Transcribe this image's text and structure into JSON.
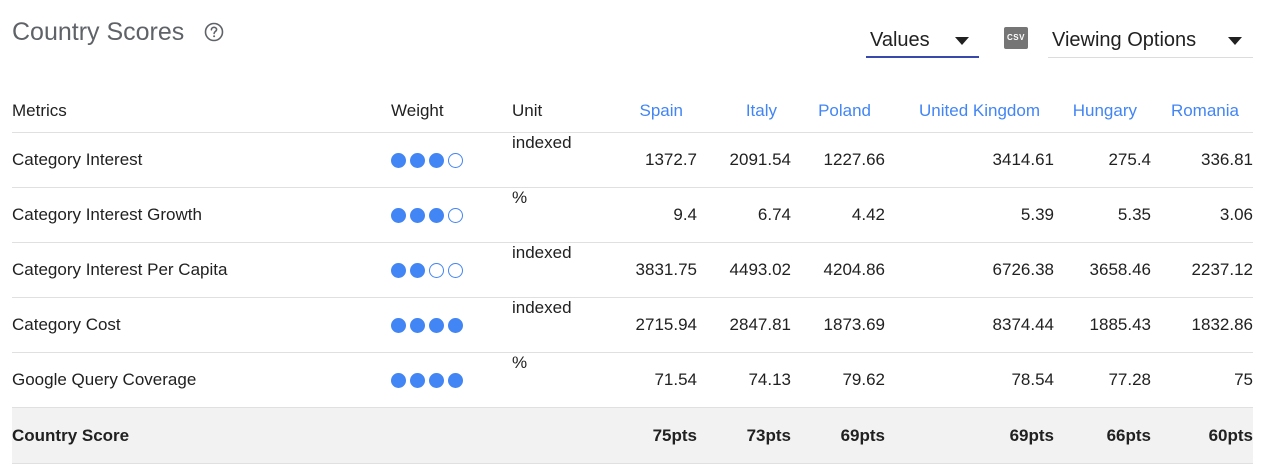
{
  "header": {
    "title": "Country Scores",
    "values_dropdown": "Values",
    "csv_label": "CSV",
    "viewing_dropdown": "Viewing Options"
  },
  "table": {
    "columns": {
      "metric": "Metrics",
      "weight": "Weight",
      "unit": "Unit",
      "countries": [
        "Spain",
        "Italy",
        "Poland",
        "United Kingdom",
        "Hungary",
        "Romania"
      ]
    },
    "rows": [
      {
        "metric": "Category Interest",
        "weight": 3,
        "weight_max": 4,
        "unit": "indexed",
        "values": [
          "1372.7",
          "2091.54",
          "1227.66",
          "3414.61",
          "275.4",
          "336.81"
        ]
      },
      {
        "metric": "Category Interest Growth",
        "weight": 3,
        "weight_max": 4,
        "unit": "%",
        "values": [
          "9.4",
          "6.74",
          "4.42",
          "5.39",
          "5.35",
          "3.06"
        ]
      },
      {
        "metric": "Category Interest Per Capita",
        "weight": 2,
        "weight_max": 4,
        "unit": "indexed",
        "values": [
          "3831.75",
          "4493.02",
          "4204.86",
          "6726.38",
          "3658.46",
          "2237.12"
        ]
      },
      {
        "metric": "Category Cost",
        "weight": 4,
        "weight_max": 4,
        "unit": "indexed",
        "values": [
          "2715.94",
          "2847.81",
          "1873.69",
          "8374.44",
          "1885.43",
          "1832.86"
        ]
      },
      {
        "metric": "Google Query Coverage",
        "weight": 4,
        "weight_max": 4,
        "unit": "%",
        "values": [
          "71.54",
          "74.13",
          "79.62",
          "78.54",
          "77.28",
          "75"
        ]
      }
    ],
    "score_row": {
      "label": "Country Score",
      "values": [
        "75pts",
        "73pts",
        "69pts",
        "69pts",
        "66pts",
        "60pts"
      ]
    }
  },
  "colors": {
    "accent_blue": "#4285f4",
    "dropdown_underline": "#3949ab",
    "title_gray": "#5f6368",
    "score_row_bg": "#f2f2f2"
  },
  "icons": {
    "help": "help-circle-icon",
    "csv": "csv-download-icon",
    "dropdown": "caret-down-icon",
    "weight": "weight-dot-icon"
  }
}
